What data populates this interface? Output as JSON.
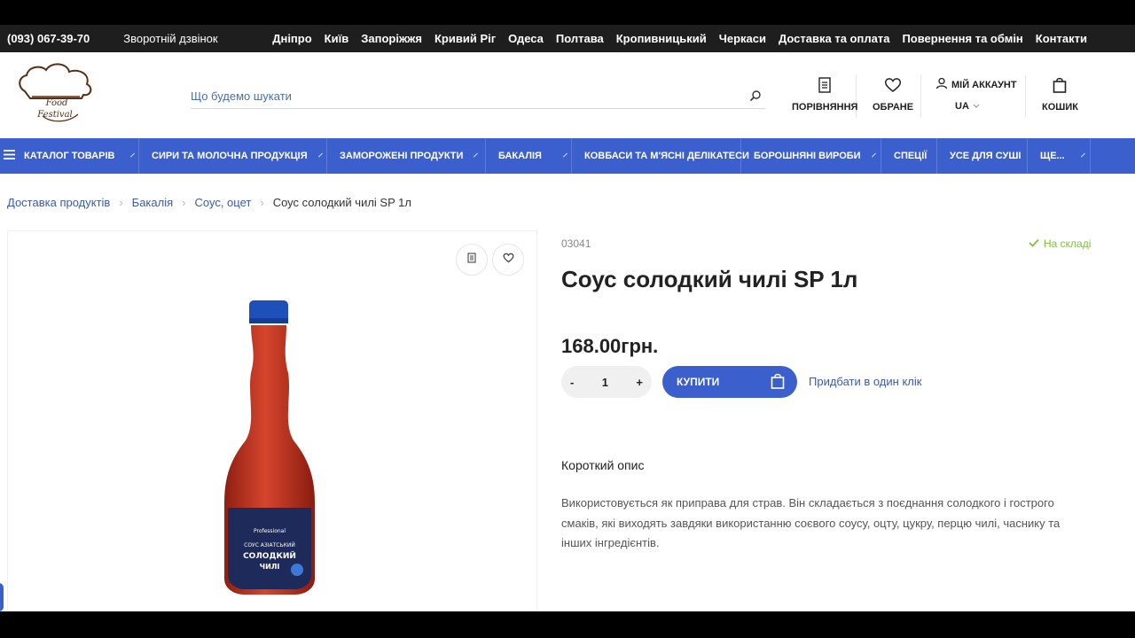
{
  "topbar": {
    "phone": "(093) 067-39-70",
    "callback": "Зворотній дзвінок",
    "links": [
      "Дніпро",
      "Київ",
      "Запоріжжя",
      "Кривий Ріг",
      "Одеса",
      "Полтава",
      "Кропивницький",
      "Черкаси",
      "Доставка та оплата",
      "Повернення та обмін",
      "Контакти"
    ]
  },
  "logo": {
    "line1": "Food",
    "line2": "Festival"
  },
  "search": {
    "placeholder": "Що будемо шукати"
  },
  "header": {
    "compare": "ПОРІВНЯННЯ",
    "favorites": "ОБРАНЕ",
    "account": "МІЙ АККАУНТ",
    "lang": "UA",
    "cart": "КОШИК"
  },
  "nav": {
    "catalog": "КАТАЛОГ ТОВАРІВ",
    "items": [
      "СИРИ ТА МОЛОЧНА ПРОДУКЦІЯ",
      "ЗАМОРОЖЕНІ ПРОДУКТИ",
      "БАКАЛІЯ",
      "КОВБАСИ ТА М'ЯСНІ ДЕЛІКАТЕСИ",
      "БОРОШНЯНІ ВИРОБИ",
      "СПЕЦІЇ",
      "УСЕ ДЛЯ СУШІ",
      "ЩЕ..."
    ]
  },
  "breadcrumb": [
    "Доставка продуктів",
    "Бакалія",
    "Соус, оцет",
    "Соус солодкий чилі SP 1л"
  ],
  "product": {
    "sku": "03041",
    "stock": "На складі",
    "title": "Соус солодкий чилі SP 1л",
    "price": "168.00грн.",
    "qty_minus": "-",
    "qty": "1",
    "qty_plus": "+",
    "buy": "КУПИТИ",
    "one_click": "Придбати в один клік",
    "short_desc_title": "Короткий опис",
    "short_desc": "Використовується як приправа для страв. Він складається з поєднання солодкого і гострого смаків, які виходять завдяки використанню соєвого соусу, оцту, цукру, перцю чилі, часнику та інших інгредієнтів.",
    "label_brand": "Professional",
    "label_line1": "СОУС АЗІАТСЬКИЙ",
    "label_line2": "СОЛОДКИЙ",
    "label_line3": "ЧИЛІ"
  },
  "colors": {
    "accent": "#3b5fcc",
    "topbar": "#1e1e1e",
    "stock": "#7fbf3f"
  }
}
